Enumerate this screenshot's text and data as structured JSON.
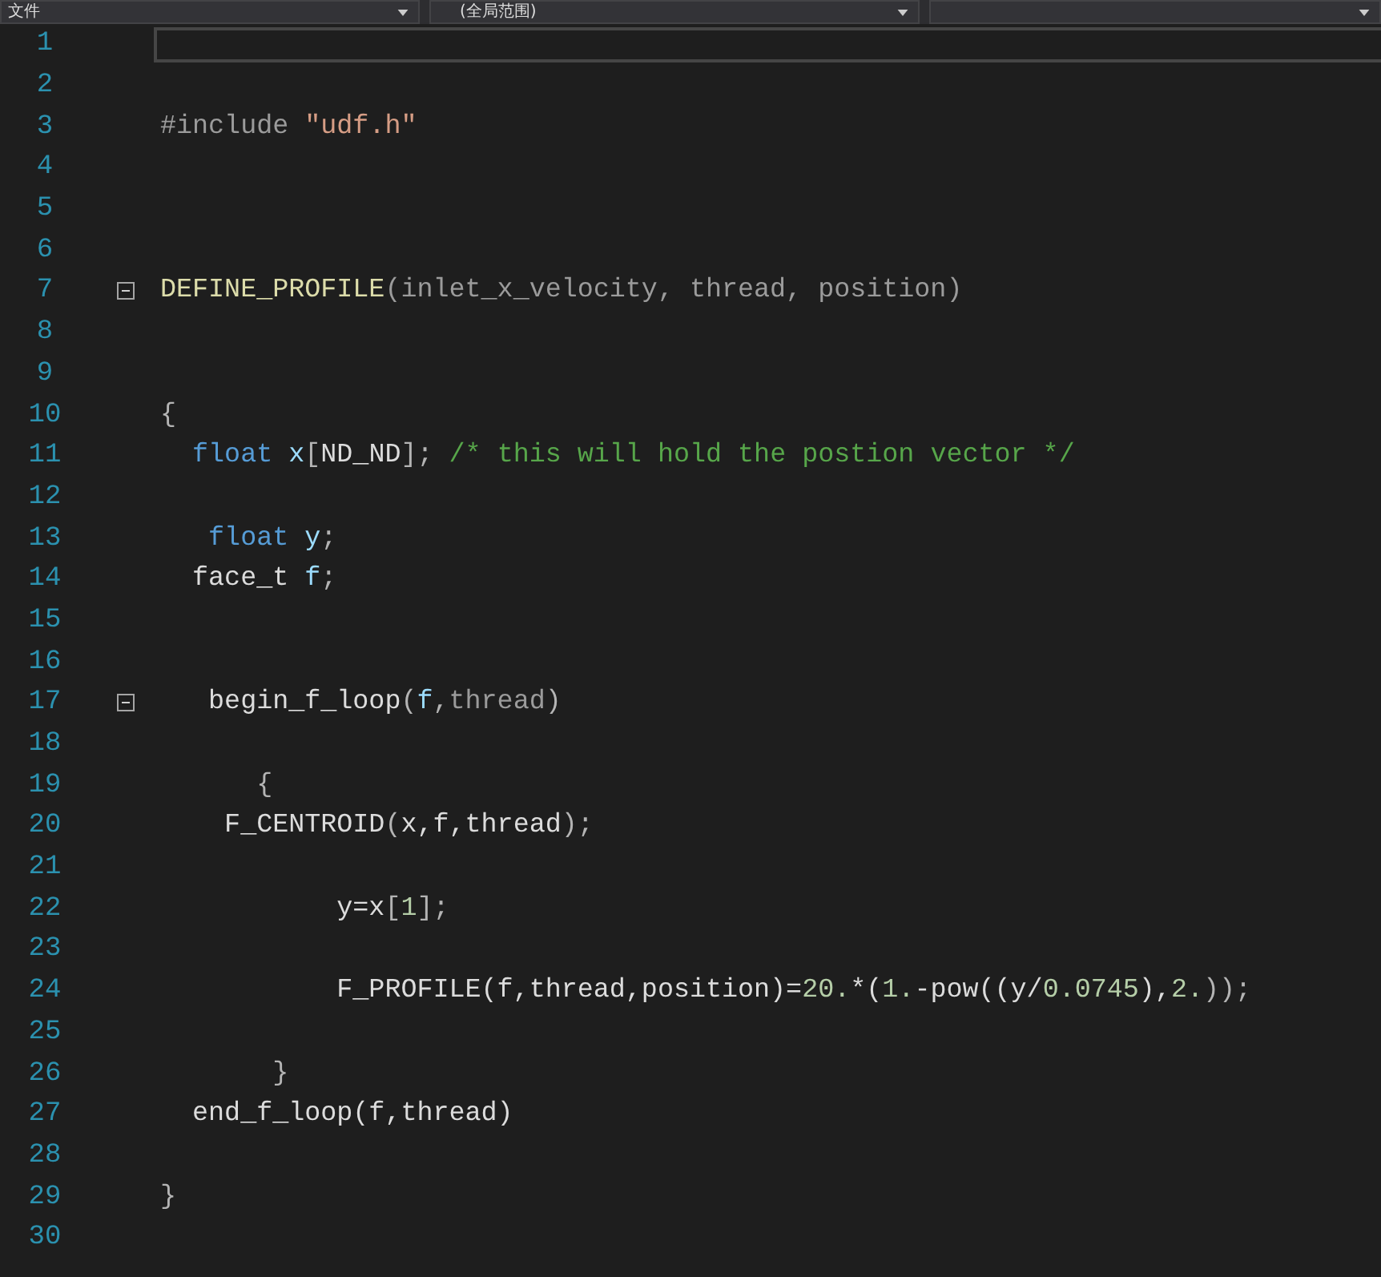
{
  "toolbar": {
    "dropdowns": [
      {
        "kind": "dropdown",
        "label": "文件"
      },
      {
        "kind": "dropdown",
        "label": "(全局范围)"
      },
      {
        "kind": "dropdown"
      }
    ]
  },
  "editor": {
    "lines": [
      {
        "number": "1",
        "current": true
      },
      {
        "number": "2",
        "current": false
      },
      {
        "number": "3",
        "current": false,
        "tokens": [
          {
            "text": "#include",
            "kind": "preprocessor"
          },
          {
            "text": " \"udf.h\"",
            "kind": "string"
          }
        ]
      },
      {
        "number": "4",
        "current": false
      },
      {
        "number": "5",
        "current": false
      },
      {
        "number": "6",
        "current": false
      },
      {
        "number": "7",
        "current": false,
        "fold": {
          "expanded": true
        },
        "tokens": [
          {
            "text": "DEFINE_PROFILE",
            "kind": "macro"
          },
          {
            "text": "(inlet_x_velocity, thread, position)",
            "kind": "param"
          }
        ]
      },
      {
        "number": "8",
        "current": false
      },
      {
        "number": "9",
        "current": false
      },
      {
        "number": "10",
        "current": false,
        "tokens": [
          {
            "text": "{",
            "kind": "punct"
          }
        ]
      },
      {
        "number": "11",
        "current": false,
        "tokens": [
          {
            "text": "  float",
            "kind": "keyword"
          },
          {
            "text": " x",
            "kind": "variable"
          },
          {
            "text": "[",
            "kind": "punct"
          },
          {
            "text": "ND_ND",
            "kind": "plain"
          },
          {
            "text": "]; ",
            "kind": "punct"
          },
          {
            "text": "/* this will hold the postion vector */",
            "kind": "comment"
          }
        ]
      },
      {
        "number": "12",
        "current": false
      },
      {
        "number": "13",
        "current": false,
        "tokens": [
          {
            "text": "   float",
            "kind": "keyword"
          },
          {
            "text": " y",
            "kind": "variable"
          },
          {
            "text": ";",
            "kind": "punct"
          }
        ]
      },
      {
        "number": "14",
        "current": false,
        "tokens": [
          {
            "text": "  face_t",
            "kind": "plain"
          },
          {
            "text": " f",
            "kind": "variable"
          },
          {
            "text": ";",
            "kind": "punct"
          }
        ]
      },
      {
        "number": "15",
        "current": false
      },
      {
        "number": "16",
        "current": false
      },
      {
        "number": "17",
        "current": false,
        "fold": {
          "expanded": true
        },
        "tokens": [
          {
            "text": "   begin_f_loop",
            "kind": "plain"
          },
          {
            "text": "(",
            "kind": "punct"
          },
          {
            "text": "f",
            "kind": "variable"
          },
          {
            "text": ",",
            "kind": "punct"
          },
          {
            "text": "thread",
            "kind": "param"
          },
          {
            "text": ")",
            "kind": "punct"
          }
        ]
      },
      {
        "number": "18",
        "current": false
      },
      {
        "number": "19",
        "current": false,
        "tokens": [
          {
            "text": "      {",
            "kind": "punct"
          }
        ]
      },
      {
        "number": "20",
        "current": false,
        "tokens": [
          {
            "text": "    F_CENTROID",
            "kind": "plain"
          },
          {
            "text": "(",
            "kind": "punct"
          },
          {
            "text": "x,f,thread",
            "kind": "plain"
          },
          {
            "text": ");",
            "kind": "punct"
          }
        ]
      },
      {
        "number": "21",
        "current": false
      },
      {
        "number": "22",
        "current": false,
        "tokens": [
          {
            "text": "           y=x",
            "kind": "plain"
          },
          {
            "text": "[",
            "kind": "punct"
          },
          {
            "text": "1",
            "kind": "number"
          },
          {
            "text": "];",
            "kind": "punct"
          }
        ]
      },
      {
        "number": "23",
        "current": false
      },
      {
        "number": "24",
        "current": false,
        "tokens": [
          {
            "text": "           F_PROFILE(f,thread,position)=",
            "kind": "plain"
          },
          {
            "text": "20.",
            "kind": "number"
          },
          {
            "text": "*(",
            "kind": "plain"
          },
          {
            "text": "1.",
            "kind": "number"
          },
          {
            "text": "-pow((y/",
            "kind": "plain"
          },
          {
            "text": "0.0745",
            "kind": "number"
          },
          {
            "text": "),",
            "kind": "plain"
          },
          {
            "text": "2.",
            "kind": "number"
          },
          {
            "text": "));",
            "kind": "punct"
          }
        ]
      },
      {
        "number": "25",
        "current": false
      },
      {
        "number": "26",
        "current": false,
        "tokens": [
          {
            "text": "       }",
            "kind": "punct"
          }
        ]
      },
      {
        "number": "27",
        "current": false,
        "tokens": [
          {
            "text": "  end_f_loop(f,thread)",
            "kind": "plain"
          }
        ]
      },
      {
        "number": "28",
        "current": false
      },
      {
        "number": "29",
        "current": false,
        "tokens": [
          {
            "text": "}",
            "kind": "punct"
          }
        ]
      },
      {
        "number": "30",
        "current": false
      }
    ]
  }
}
